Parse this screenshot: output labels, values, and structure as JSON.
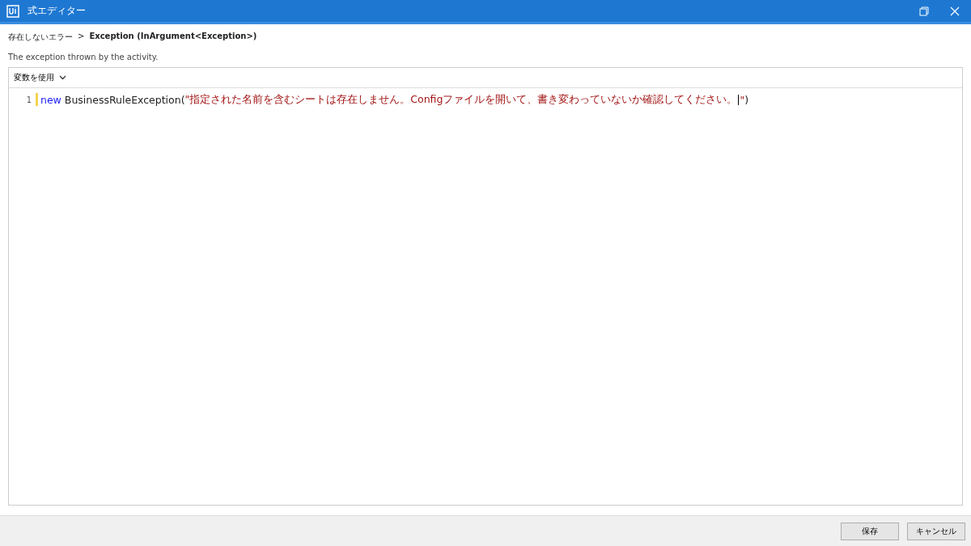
{
  "window": {
    "title": "式エディター"
  },
  "breadcrumb": {
    "parent": "存在しないエラー",
    "separator": ">",
    "current": "Exception (InArgument<Exception>)"
  },
  "description": "The exception thrown by the activity.",
  "editor": {
    "toolbar": {
      "label": "変数を使用"
    },
    "lines": [
      {
        "number": "1",
        "tokens": [
          {
            "kind": "keyword",
            "text": "new "
          },
          {
            "kind": "plain",
            "text": "BusinessRuleException("
          },
          {
            "kind": "string",
            "text": "\"指定された名前を含むシートは存在しません。Configファイルを開いて、書き変わっていないか確認してください。"
          },
          {
            "kind": "cursor"
          },
          {
            "kind": "string",
            "text": "\""
          },
          {
            "kind": "plain",
            "text": ")"
          }
        ]
      }
    ]
  },
  "buttons": [
    {
      "label": "保存"
    },
    {
      "label": "キャンセル"
    }
  ]
}
